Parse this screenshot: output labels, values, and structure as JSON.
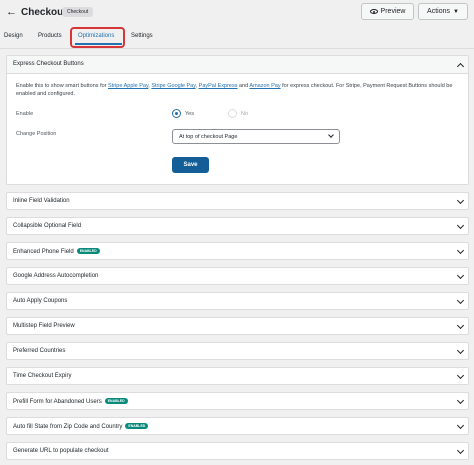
{
  "header": {
    "title": "Checkout",
    "badge": "Checkout",
    "preview_label": "Preview",
    "actions_label": "Actions"
  },
  "tabs": [
    "Design",
    "Products",
    "Optimizations",
    "Settings"
  ],
  "active_tab": "Optimizations",
  "express": {
    "title": "Express Checkout Buttons",
    "desc_pre": "Enable this to show smart buttons for ",
    "link1": "Stripe Apple Pay",
    "sep1": ", ",
    "link2": "Stripe Google Pay",
    "sep2": ", ",
    "link3": "PayPal Express",
    "sep3": " and ",
    "link4": "Amazon Pay",
    "desc_post": " for express checkout. For Stripe, Payment Request Buttons should be enabled and configured.",
    "enable_label": "Enable",
    "yes_label": "Yes",
    "no_label": "No",
    "position_label": "Change Position",
    "position_value": "At top of checkout Page",
    "save_label": "Save"
  },
  "sections": [
    {
      "label": "Inline Field Validation",
      "badge": ""
    },
    {
      "label": "Collapsible Optional Field",
      "badge": ""
    },
    {
      "label": "Enhanced Phone Field",
      "badge": "ENABLED"
    },
    {
      "label": "Google Address Autocompletion",
      "badge": ""
    },
    {
      "label": "Auto Apply Coupons",
      "badge": ""
    },
    {
      "label": "Multistep Field Preview",
      "badge": ""
    },
    {
      "label": "Preferred Countries",
      "badge": ""
    },
    {
      "label": "Time Checkout Expiry",
      "badge": ""
    },
    {
      "label": "Prefill Form for Abandoned Users",
      "badge": "ENABLED"
    },
    {
      "label": "Auto fill State from Zip Code and Country",
      "badge": "ENABLED"
    },
    {
      "label": "Generate URL to populate checkout",
      "badge": ""
    }
  ],
  "colors": {
    "accent": "#2271b1",
    "save": "#135e96",
    "enabled_badge": "#0a8a7a",
    "highlight": "#d63638"
  }
}
